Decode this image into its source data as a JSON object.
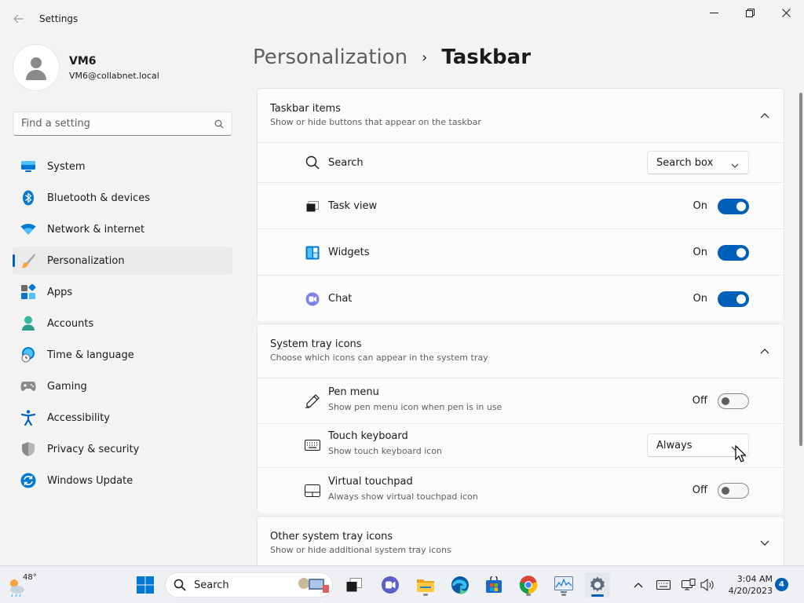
{
  "window": {
    "title": "Settings",
    "back_icon": "back-arrow-icon",
    "controls": [
      "minimize-icon",
      "maximize-icon",
      "close-icon"
    ]
  },
  "profile": {
    "name": "VM6",
    "email": "VM6@collabnet.local"
  },
  "search": {
    "placeholder": "Find a setting"
  },
  "nav": {
    "items": [
      {
        "label": "System",
        "icon": "system-icon"
      },
      {
        "label": "Bluetooth & devices",
        "icon": "bluetooth-icon"
      },
      {
        "label": "Network & internet",
        "icon": "wifi-icon"
      },
      {
        "label": "Personalization",
        "icon": "brush-icon",
        "active": true
      },
      {
        "label": "Apps",
        "icon": "apps-icon"
      },
      {
        "label": "Accounts",
        "icon": "accounts-icon"
      },
      {
        "label": "Time & language",
        "icon": "clock-globe-icon"
      },
      {
        "label": "Gaming",
        "icon": "gamepad-icon"
      },
      {
        "label": "Accessibility",
        "icon": "accessibility-icon"
      },
      {
        "label": "Privacy & security",
        "icon": "shield-icon"
      },
      {
        "label": "Windows Update",
        "icon": "update-icon"
      }
    ]
  },
  "breadcrumb": {
    "parent": "Personalization",
    "separator": "›",
    "current": "Taskbar"
  },
  "taskbar_items": {
    "title": "Taskbar items",
    "description": "Show or hide buttons that appear on the taskbar",
    "rows": [
      {
        "label": "Search",
        "control": "dropdown",
        "value": "Search box"
      },
      {
        "label": "Task view",
        "state": "On"
      },
      {
        "label": "Widgets",
        "state": "On"
      },
      {
        "label": "Chat",
        "state": "On"
      }
    ]
  },
  "system_tray": {
    "title": "System tray icons",
    "description": "Choose which icons can appear in the system tray",
    "rows": [
      {
        "label": "Pen menu",
        "sub": "Show pen menu icon when pen is in use",
        "state": "Off"
      },
      {
        "label": "Touch keyboard",
        "sub": "Show touch keyboard icon",
        "control": "dropdown",
        "value": "Always"
      },
      {
        "label": "Virtual touchpad",
        "sub": "Always show virtual touchpad icon",
        "state": "Off"
      }
    ]
  },
  "other_tray": {
    "title": "Other system tray icons",
    "description": "Show or hide additional system tray icons"
  },
  "taskbar": {
    "weather_temp": "48°",
    "search_label": "Search",
    "time": "3:04 AM",
    "date": "4/20/2023",
    "notification_count": "4"
  },
  "colors": {
    "accent": "#005fb8",
    "background": "#f3f3f3",
    "card": "#fbfbfb"
  }
}
